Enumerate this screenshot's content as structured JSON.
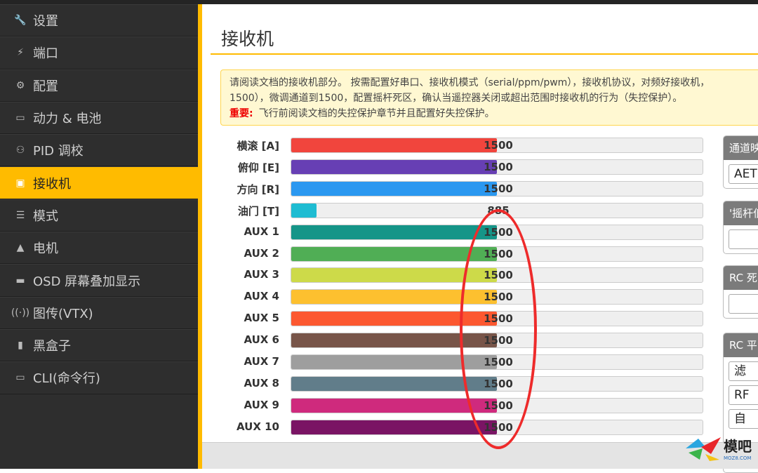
{
  "sidebar": {
    "items": [
      {
        "label": "设置",
        "icon": "wrench-icon",
        "glyph": "🔧"
      },
      {
        "label": "端口",
        "icon": "plug-icon",
        "glyph": "⚡"
      },
      {
        "label": "配置",
        "icon": "gear-icon",
        "glyph": "⚙"
      },
      {
        "label": "动力 & 电池",
        "icon": "battery-icon",
        "glyph": "▭"
      },
      {
        "label": "PID 调校",
        "icon": "hierarchy-icon",
        "glyph": "⚇"
      },
      {
        "label": "接收机",
        "icon": "receiver-icon",
        "glyph": "▣",
        "active": true
      },
      {
        "label": "模式",
        "icon": "toggle-icon",
        "glyph": "☰"
      },
      {
        "label": "电机",
        "icon": "motor-icon",
        "glyph": "▲"
      },
      {
        "label": "OSD 屏幕叠加显示",
        "icon": "osd-icon",
        "glyph": "▬"
      },
      {
        "label": "图传(VTX)",
        "icon": "antenna-icon",
        "glyph": "((·))"
      },
      {
        "label": "黑盒子",
        "icon": "chip-icon",
        "glyph": "▮"
      },
      {
        "label": "CLI(命令行)",
        "icon": "terminal-icon",
        "glyph": "▭"
      }
    ]
  },
  "page": {
    "title": "接收机"
  },
  "notice": {
    "line1": "请阅读文档的接收机部分。 按需配置好串口、接收机模式（serial/ppm/pwm），接收机协议，对频好接收机，",
    "line2": "1500），微调通道到1500，配置摇杆死区，确认当遥控器关闭或超出范围时接收机的行为（失控保护）。",
    "important_label": "重要:",
    "important_text": "飞行前阅读文档的失控保护章节并且配置好失控保护。"
  },
  "channel_range": [
    800,
    2200
  ],
  "channels": [
    {
      "label": "横滚 [A]",
      "value": "1500",
      "color": "#f1453d"
    },
    {
      "label": "俯仰 [E]",
      "value": "1500",
      "color": "#673fb4"
    },
    {
      "label": "方向 [R]",
      "value": "1500",
      "color": "#2b98f0"
    },
    {
      "label": "油门 [T]",
      "value": "885",
      "color": "#1fbcd2"
    },
    {
      "label": "AUX 1",
      "value": "1500",
      "color": "#159588"
    },
    {
      "label": "AUX 2",
      "value": "1500",
      "color": "#50ae55"
    },
    {
      "label": "AUX 3",
      "value": "1500",
      "color": "#cdda49"
    },
    {
      "label": "AUX 4",
      "value": "1500",
      "color": "#fdc02f"
    },
    {
      "label": "AUX 5",
      "value": "1500",
      "color": "#fc5830"
    },
    {
      "label": "AUX 6",
      "value": "1500",
      "color": "#785549"
    },
    {
      "label": "AUX 7",
      "value": "1500",
      "color": "#9e9e9e"
    },
    {
      "label": "AUX 8",
      "value": "1500",
      "color": "#617d8a"
    },
    {
      "label": "AUX 9",
      "value": "1500",
      "color": "#cf2a7d"
    },
    {
      "label": "AUX 10",
      "value": "1500",
      "color": "#7a1464"
    }
  ],
  "panels": [
    {
      "header": "通道映",
      "fields": [
        "AET"
      ]
    },
    {
      "header": "'摇杆低",
      "fields": [
        ""
      ]
    },
    {
      "header": "RC 死",
      "fields": [
        ""
      ]
    },
    {
      "header": "RC 平",
      "fields": [
        "滤",
        "RF",
        "自"
      ]
    }
  ],
  "watermark": {
    "text": "模吧",
    "sub": "MOZ8.COM"
  },
  "colors": {
    "accent": "#ffbb00",
    "annotation": "#ee2b2b"
  }
}
